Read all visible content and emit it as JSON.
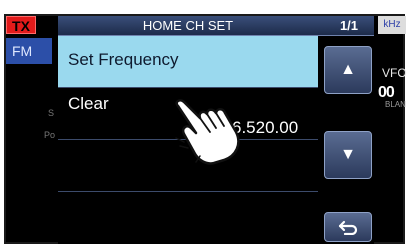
{
  "status": {
    "tx": "TX",
    "mode": "FM",
    "unit": "kHz",
    "vfo": "VFO",
    "vfo_digits": "00",
    "blank": "BLAN",
    "side_s": "S",
    "side_po": "Po"
  },
  "dialog": {
    "title": "HOME CH SET",
    "page": "1/1",
    "items": [
      {
        "label": "Set Frequency",
        "value": ""
      },
      {
        "label": "Clear",
        "value": "6.520.00"
      },
      {
        "label": "",
        "value": ""
      },
      {
        "label": "",
        "value": ""
      }
    ],
    "selected_index": 0
  },
  "buttons": {
    "up": "up-arrow-icon",
    "down": "down-arrow-icon",
    "back": "return-icon"
  },
  "colors": {
    "selected_row": "#9ad9ee",
    "tx": "#e21b1b",
    "header": "#2a3b63"
  }
}
